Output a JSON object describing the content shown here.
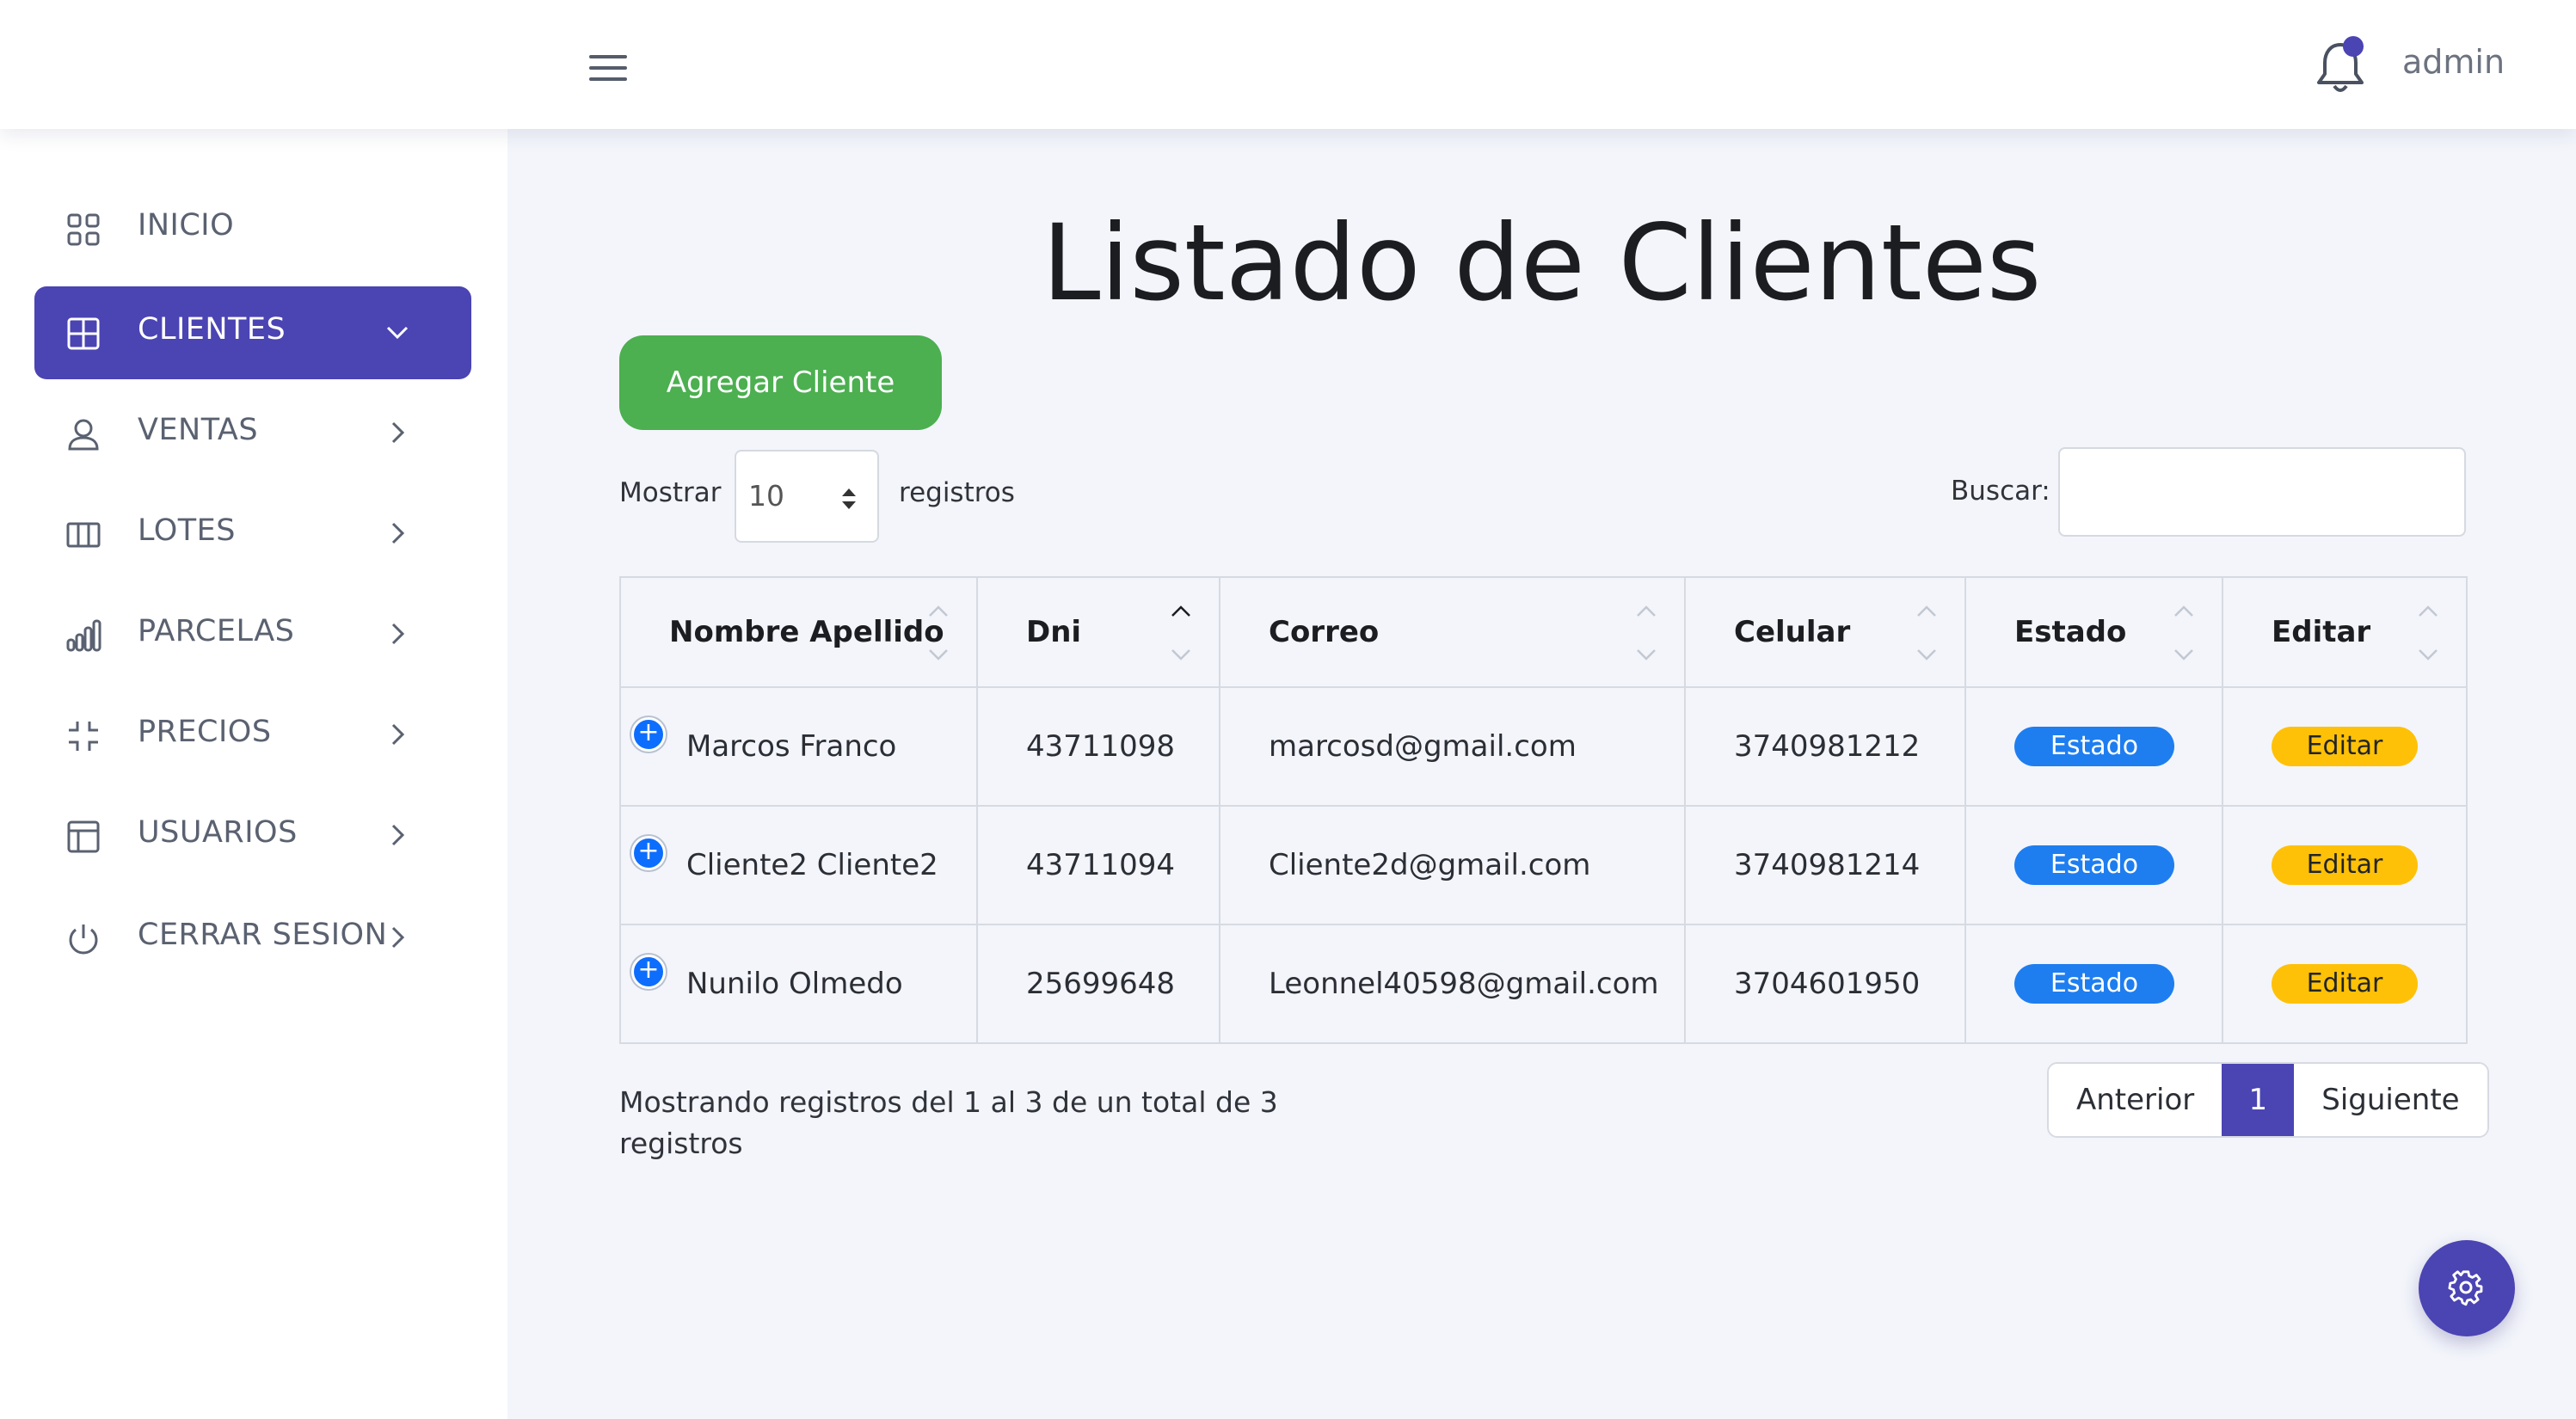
{
  "header": {
    "user_label": "admin"
  },
  "sidebar": {
    "items": [
      {
        "label": "INICIO",
        "icon": "grid-icon"
      },
      {
        "label": "CLIENTES",
        "icon": "table-icon",
        "active": true
      },
      {
        "label": "VENTAS",
        "icon": "user-icon"
      },
      {
        "label": "LOTES",
        "icon": "columns-icon"
      },
      {
        "label": "PARCELAS",
        "icon": "bar-chart-icon"
      },
      {
        "label": "PRECIOS",
        "icon": "collapse-icon"
      },
      {
        "label": "USUARIOS",
        "icon": "layout-icon"
      },
      {
        "label": "CERRAR SESION",
        "icon": "power-icon"
      }
    ]
  },
  "main": {
    "title": "Listado de Clientes",
    "add_button": "Agregar Cliente",
    "show_label": "Mostrar",
    "page_size": "10",
    "records_label": "registros",
    "search_label": "Buscar:",
    "search_value": ""
  },
  "table": {
    "columns": [
      "Nombre Apellido",
      "Dni",
      "Correo",
      "Celular",
      "Estado",
      "Editar"
    ],
    "rows": [
      {
        "nombre": "Marcos Franco",
        "dni": "43711098",
        "correo": "marcosd@gmail.com",
        "celular": "3740981212",
        "estado": "Estado",
        "editar": "Editar"
      },
      {
        "nombre": "Cliente2 Cliente2",
        "dni": "43711094",
        "correo": "Cliente2d@gmail.com",
        "celular": "3740981214",
        "estado": "Estado",
        "editar": "Editar"
      },
      {
        "nombre": "Nunilo Olmedo",
        "dni": "25699648",
        "correo": "Leonnel40598@gmail.com",
        "celular": "3704601950",
        "estado": "Estado",
        "editar": "Editar"
      }
    ],
    "sorted_column": "Dni",
    "sort_direction": "ascending"
  },
  "footer": {
    "info": "Mostrando registros del 1 al 3 de un total de 3 registros",
    "prev": "Anterior",
    "page": "1",
    "next": "Siguiente"
  },
  "colors": {
    "primary": "#4b44b3",
    "success": "#4caf50",
    "badge_estado": "#1e7ef0",
    "badge_editar": "#ffc107",
    "background": "#f3f5fb"
  }
}
